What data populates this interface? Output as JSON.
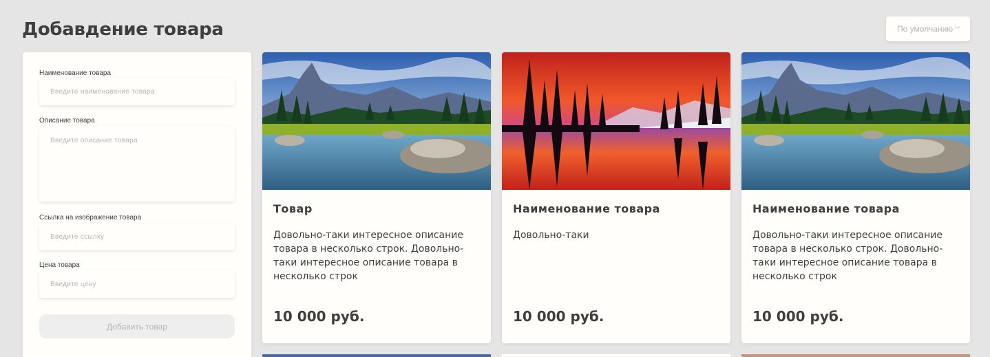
{
  "page": {
    "title": "Добавдение товара"
  },
  "sort": {
    "selected": "По умолчанию",
    "icon": "chevron-down-icon"
  },
  "form": {
    "name": {
      "label": "Наименование товара",
      "placeholder": "Введите наименование товара"
    },
    "description": {
      "label": "Описание товара",
      "placeholder": "Введите  описание  товара"
    },
    "image_link": {
      "label": "Ссылка на изображение товара",
      "placeholder": "Введите ссылку"
    },
    "price": {
      "label": "Цена товара",
      "placeholder": "Введите цену"
    },
    "submit_label": "Добавить товар"
  },
  "cards": [
    {
      "title": "Товар",
      "description": "Довольно-таки интересное описание товара в несколько строк. Довольно-таки интересное описание товара в несколько строк",
      "price": "10 000 руб.",
      "image": "mountain-lake-photo"
    },
    {
      "title": "Наименование товара",
      "description": "Довольно-таки",
      "price": "10 000 руб.",
      "image": "sunset-lake-photo"
    },
    {
      "title": "Наименование товара",
      "description": "Довольно-таки интересное описание товара в несколько строк. Довольно-таки интересное описание товара в несколько строк",
      "price": "10 000 руб.",
      "image": "mountain-lake-photo"
    }
  ],
  "colors": {
    "background": "#e5e5e5",
    "surface": "#fffefb",
    "text": "#3f3f3f",
    "placeholder": "#b4b4b4",
    "button_disabled": "#eeeeee"
  }
}
